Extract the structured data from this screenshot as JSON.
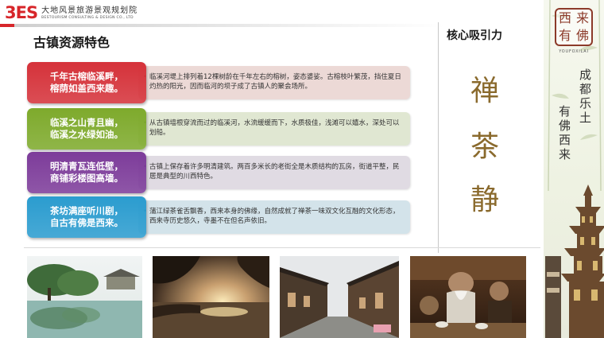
{
  "header": {
    "logo_mark": "3ES",
    "company_cn": "大地风景旅游景观规划院",
    "company_en": "BESTOURISM CONSULTING & DESIGN CO., LTD"
  },
  "section_title": "古镇资源特色",
  "features": [
    {
      "label": "千年古榕临溪畔，\n榕荫如盖西来趣。",
      "description": "临溪河堤上排列着12棵树龄在千年左右的榕树，姿态婆娑。古榕枝叶繁茂，挡住夏日灼热的阳光，因而临河的坝子成了古镇人的聚会场所。",
      "color": "#d5323a",
      "bar_color": "#ecd9d6"
    },
    {
      "label": "临溪之山青且幽，\n临溪之水绿如油。",
      "description": "从古镇墙根穿流而过的临溪河，水流缓缓而下，水质极佳，浅滩可以嬉水，深处可以划船。",
      "color": "#7eaa2c",
      "bar_color": "#e0e7d2"
    },
    {
      "label": "明清青瓦连低壁，\n商铺彩楼图高墙。",
      "description": "古镇上保存着许多明清建筑。两百多米长的老街全是木质结构的瓦房，街道平整，民居是典型的川西特色。",
      "color": "#7d3c9a",
      "bar_color": "#e0dbe3"
    },
    {
      "label": "茶坊满座听川剧，\n自古有佛是西来。",
      "description": "蒲江绿茶雀舌飘香，西来本身的佛缘，自然成就了禅茶一味双文化互融的文化形态，西来寺历史悠久，寺墨不在但名声依旧。",
      "color": "#2b9ccf",
      "bar_color": "#d3e3ea"
    }
  ],
  "core": {
    "title": "核心吸引力",
    "chars": [
      "禅",
      "茶",
      "静"
    ]
  },
  "banner": {
    "seal_chars": [
      "西",
      "来",
      "有",
      "佛"
    ],
    "seal_caption": "YOUFOXILAI",
    "vertical_1": "成都乐土",
    "vertical_2": "有佛西来"
  },
  "colors": {
    "brand_red": "#d7262a",
    "core_char_gold": "#8a6a2d"
  }
}
